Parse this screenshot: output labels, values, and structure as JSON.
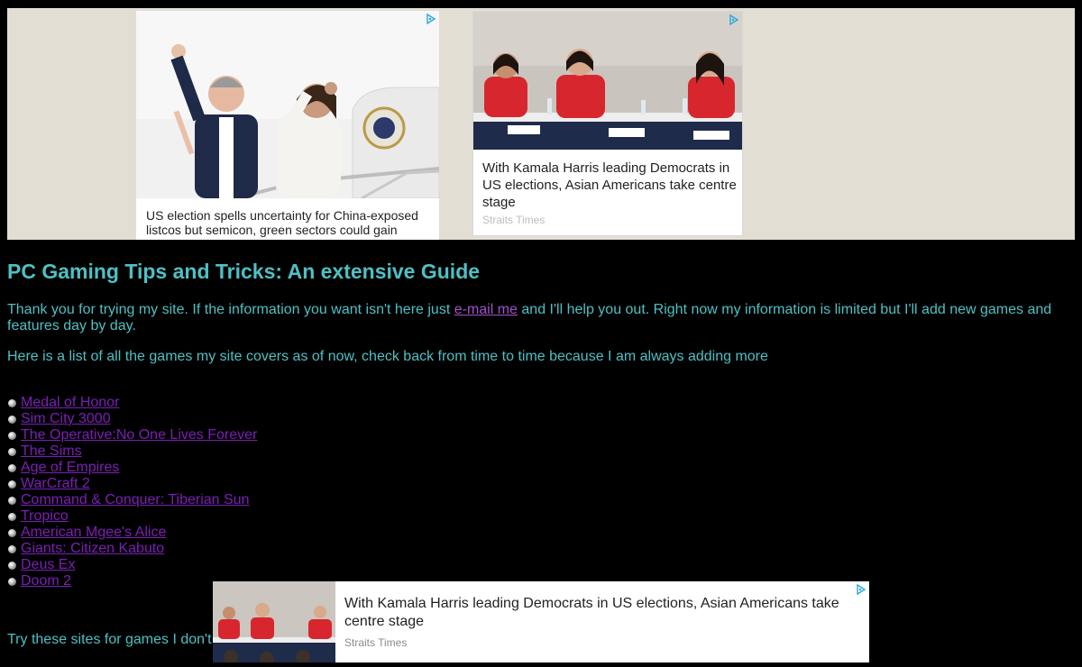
{
  "ads": {
    "top_left": {
      "headline": "US election spells uncertainty for China-exposed listcos but semicon, green sectors could gain"
    },
    "top_right": {
      "headline": "With Kamala Harris leading Democrats in US elections, Asian Americans take centre stage",
      "source": "Straits Times"
    },
    "bottom": {
      "headline": "With Kamala Harris leading Democrats in US elections, Asian Americans take centre stage",
      "source": "Straits Times"
    }
  },
  "page": {
    "title": "PC Gaming Tips and Tricks: An extensive Guide",
    "intro_before": "Thank you for trying my site. If the information you want isn't here just ",
    "intro_link": "e-mail me",
    "intro_after": " and I'll help you out. Right now my information is limited but I'll add new games and features day by day.",
    "list_intro": "Here is a list of all the games my site covers as of now, check back from time to time because I am always adding more",
    "games": [
      "Medal of Honor",
      "Sim City 3000",
      "The Operative:No One Lives Forever",
      "The Sims",
      "Age of Empires",
      "WarCraft 2",
      "Command & Conquer: Tiberian Sun",
      "Tropico",
      "American Mgee's Alice",
      "Giants: Citizen Kabuto",
      "Deus Ex",
      "Doom 2"
    ],
    "bottom_text": "Try these sites for games I don't"
  },
  "colors": {
    "background": "#000000",
    "text": "#4ec0c4",
    "link": "#7c1fb5",
    "ad_strip": "#e2ded3"
  },
  "icons": {
    "ad_choices": "adchoices-icon",
    "list_bullet": "bullet-icon"
  }
}
